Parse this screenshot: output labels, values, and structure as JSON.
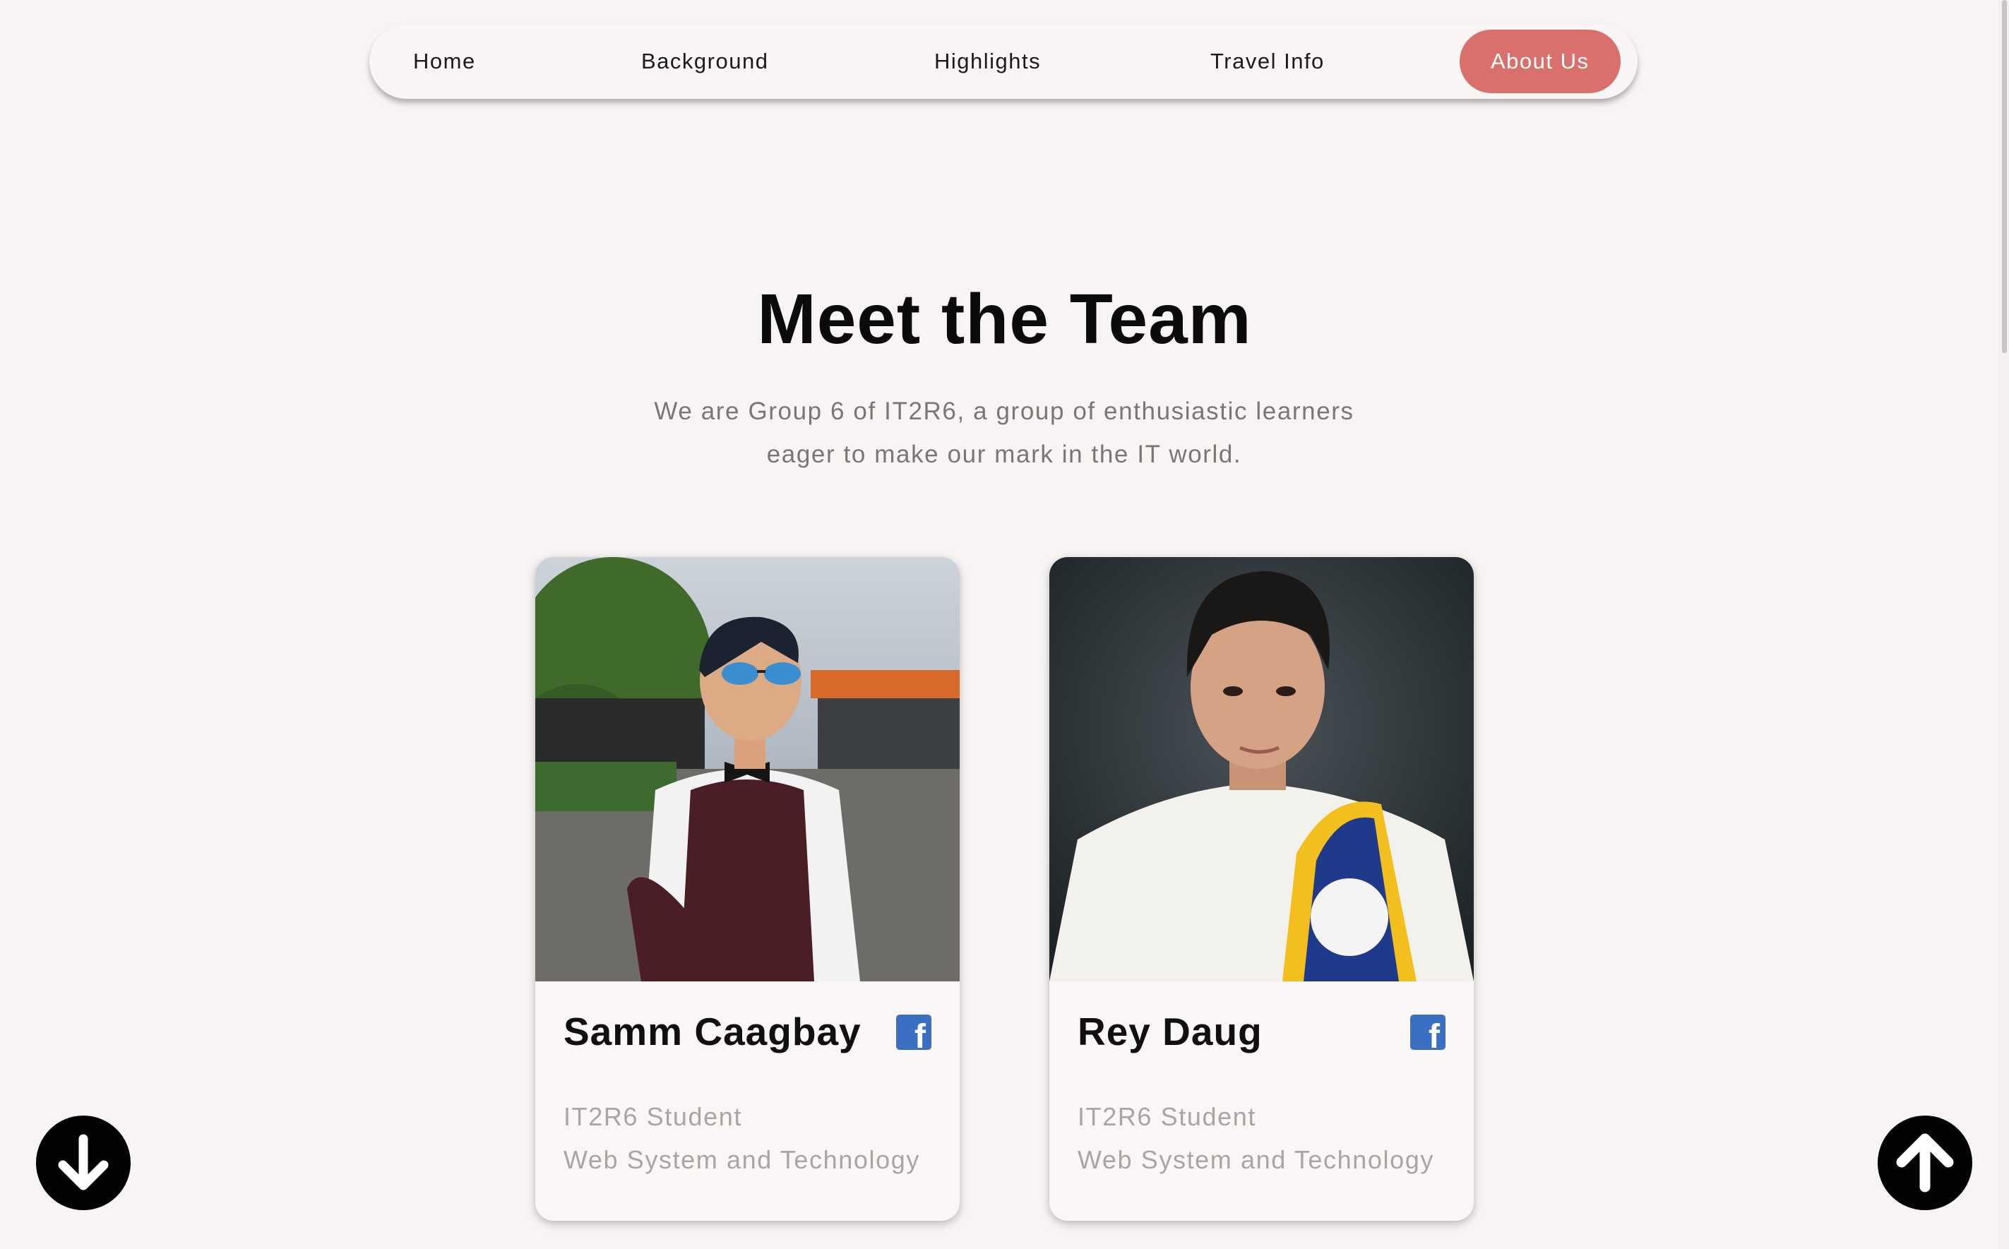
{
  "nav": {
    "items": [
      {
        "label": "Home"
      },
      {
        "label": "Background"
      },
      {
        "label": "Highlights"
      },
      {
        "label": "Travel Info"
      },
      {
        "label": "About Us",
        "active": true
      }
    ],
    "active_color": "#d9706b"
  },
  "main": {
    "title": "Meet the Team",
    "subtitle_lines": [
      "We are Group 6 of IT2R6, a group of enthusiastic learners",
      "eager to make our mark in the IT world."
    ]
  },
  "team": [
    {
      "name": "Samm Caagbay",
      "role_lines": [
        "IT2R6 Student",
        "Web System and Technology"
      ],
      "social_icon": "facebook-icon"
    },
    {
      "name": "Rey Daug",
      "role_lines": [
        "IT2R6 Student",
        "Web System and Technology"
      ],
      "social_icon": "facebook-icon"
    }
  ],
  "controls": {
    "scroll_down_icon": "arrow-down-icon",
    "scroll_up_icon": "arrow-up-icon"
  },
  "colors": {
    "background": "#f7f4f3",
    "facebook": "#3b6fc4",
    "button": "#030303"
  }
}
